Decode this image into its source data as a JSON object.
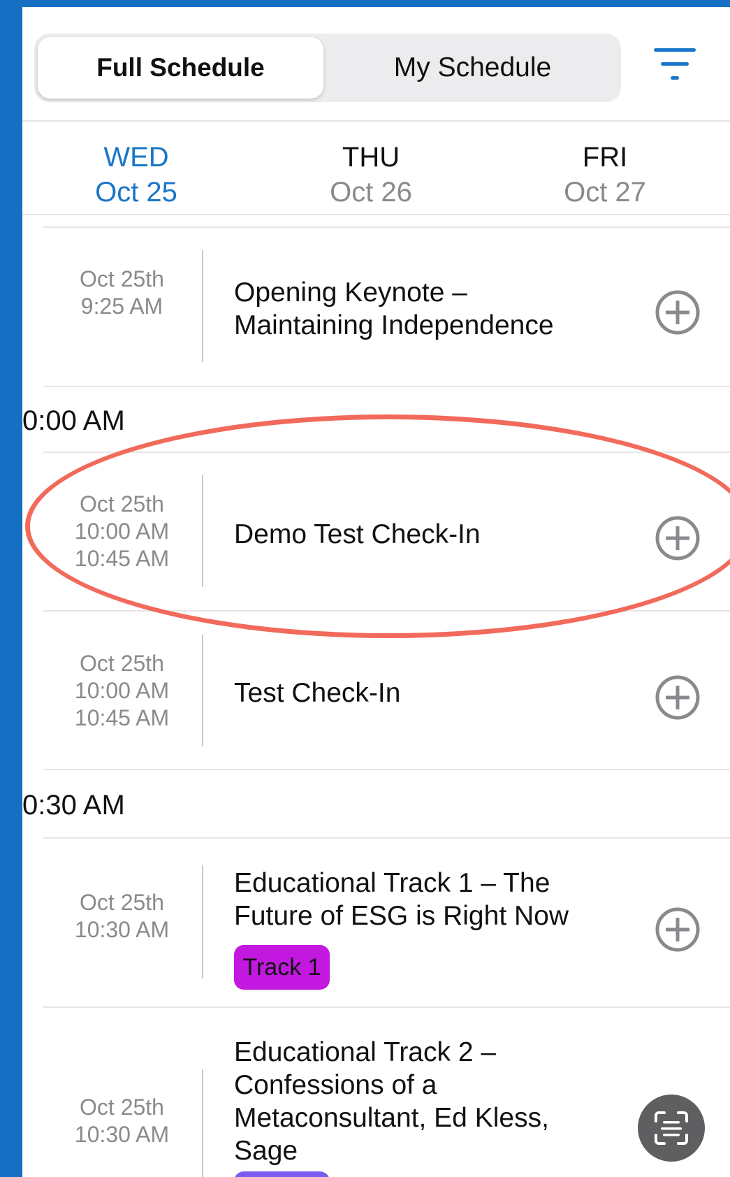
{
  "segment": {
    "full": "Full Schedule",
    "mine": "My Schedule"
  },
  "days": [
    {
      "dow": "WED",
      "date": "Oct 25"
    },
    {
      "dow": "THU",
      "date": "Oct 26"
    },
    {
      "dow": "FRI",
      "date": "Oct 27"
    }
  ],
  "time_headers": [
    "0:00 AM",
    "0:30 AM"
  ],
  "sessions": [
    {
      "date": "Oct 25th",
      "start": "9:25 AM",
      "end": "",
      "title_l1": "Opening Keynote –",
      "title_l2": "Maintaining Independence"
    },
    {
      "date": "Oct 25th",
      "start": "10:00 AM",
      "end": "10:45 AM",
      "title_l1": "Demo Test Check-In"
    },
    {
      "date": "Oct 25th",
      "start": "10:00 AM",
      "end": "10:45 AM",
      "title_l1": "Test Check-In"
    },
    {
      "date": "Oct 25th",
      "start": "10:30 AM",
      "end": "",
      "title_l1": "Educational Track 1 – The",
      "title_l2": "Future of ESG is Right Now",
      "badge": "Track 1"
    },
    {
      "date": "Oct 25th",
      "start": "10:30 AM",
      "end": "",
      "title_l1": "Educational Track 2 –",
      "title_l2": "Confessions of a",
      "title_l3": "Metaconsultant, Ed Kless,",
      "title_l4": "Sage"
    }
  ],
  "colors": {
    "accent": "#1a76c8",
    "badge": "#c218e0",
    "highlight": "#f26a5b",
    "frame": "#1570c4"
  },
  "icons": {
    "filter": "filter-icon",
    "add": "add-circle-icon",
    "fab": "scan-icon"
  }
}
